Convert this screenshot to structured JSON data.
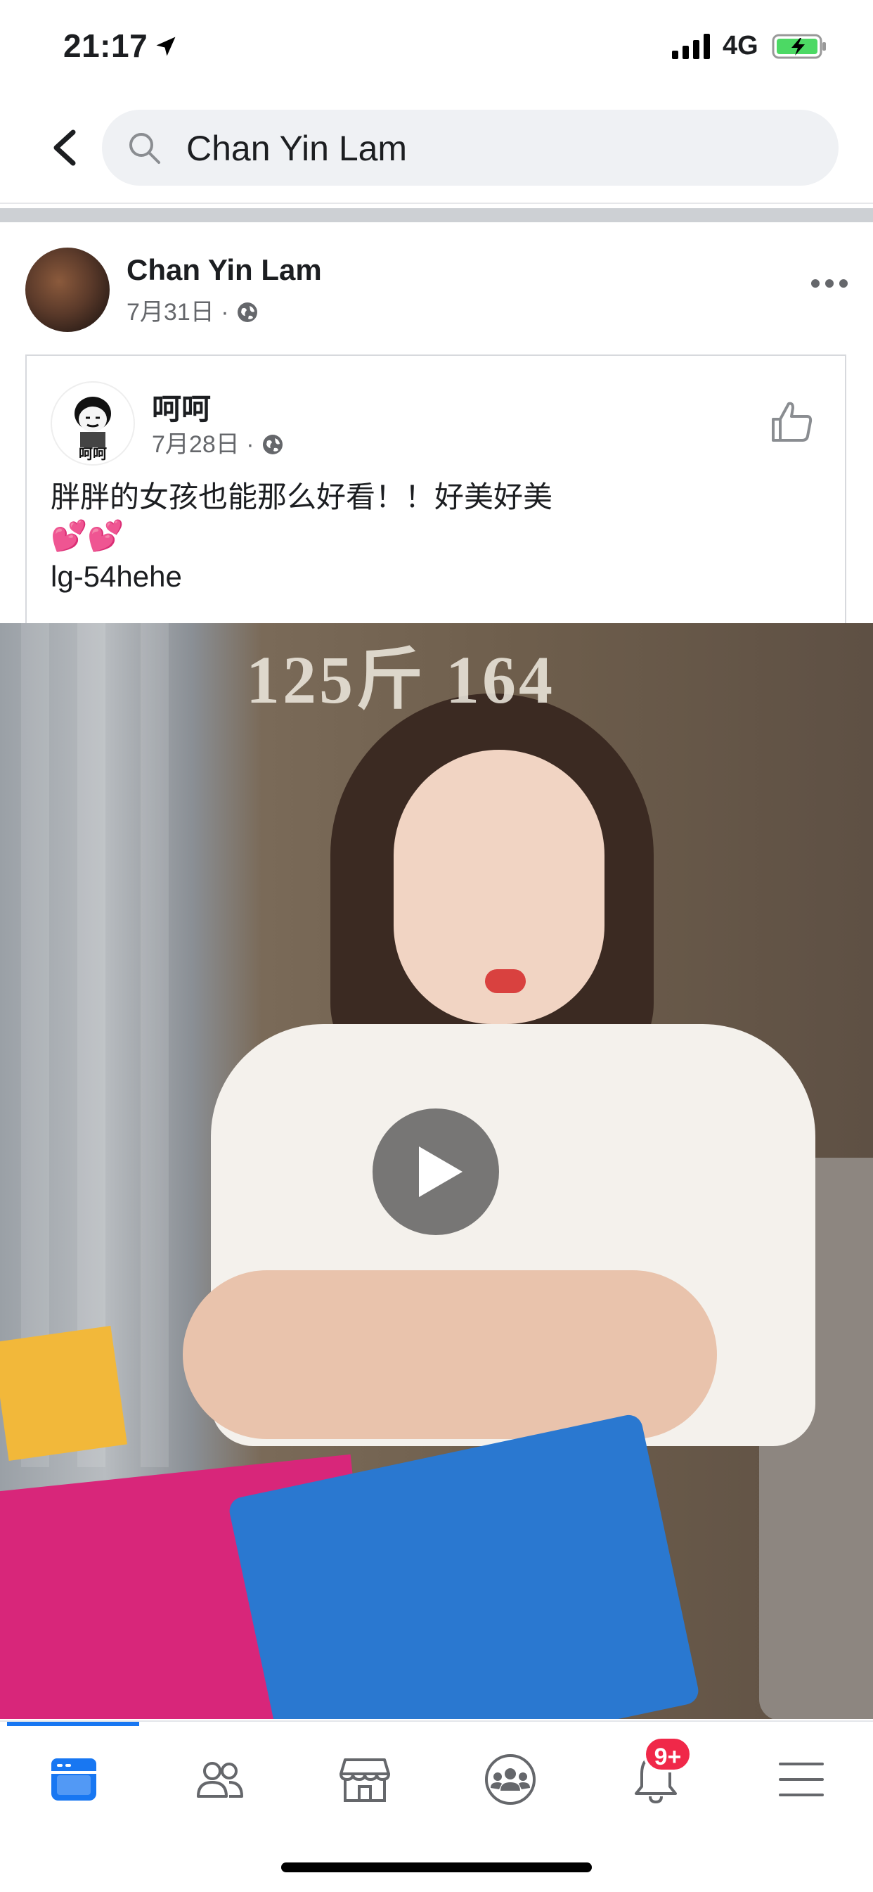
{
  "status_bar": {
    "time": "21:17",
    "network": "4G"
  },
  "search": {
    "query": "Chan Yin Lam"
  },
  "post": {
    "author": "Chan Yin Lam",
    "date": "7月31日",
    "separator": "·"
  },
  "shared_post": {
    "author": "呵呵",
    "date": "7月28日",
    "separator": "·",
    "text": "胖胖的女孩也能那么好看！！好美好美",
    "hearts": "💕💕",
    "tag": "lg-54hehe",
    "avatar_caption": "呵呵"
  },
  "video": {
    "overlay_text": "125斤  164"
  },
  "tabbar": {
    "items": [
      {
        "name": "news-feed",
        "icon": "news-feed-icon",
        "active": true
      },
      {
        "name": "friends",
        "icon": "friends-icon"
      },
      {
        "name": "marketplace",
        "icon": "marketplace-icon"
      },
      {
        "name": "groups",
        "icon": "groups-icon"
      },
      {
        "name": "notifications",
        "icon": "bell-icon",
        "badge": "9+"
      },
      {
        "name": "menu",
        "icon": "menu-icon"
      }
    ]
  },
  "colors": {
    "accent": "#1877f2",
    "badge": "#f02849",
    "battery": "#4cd964"
  }
}
